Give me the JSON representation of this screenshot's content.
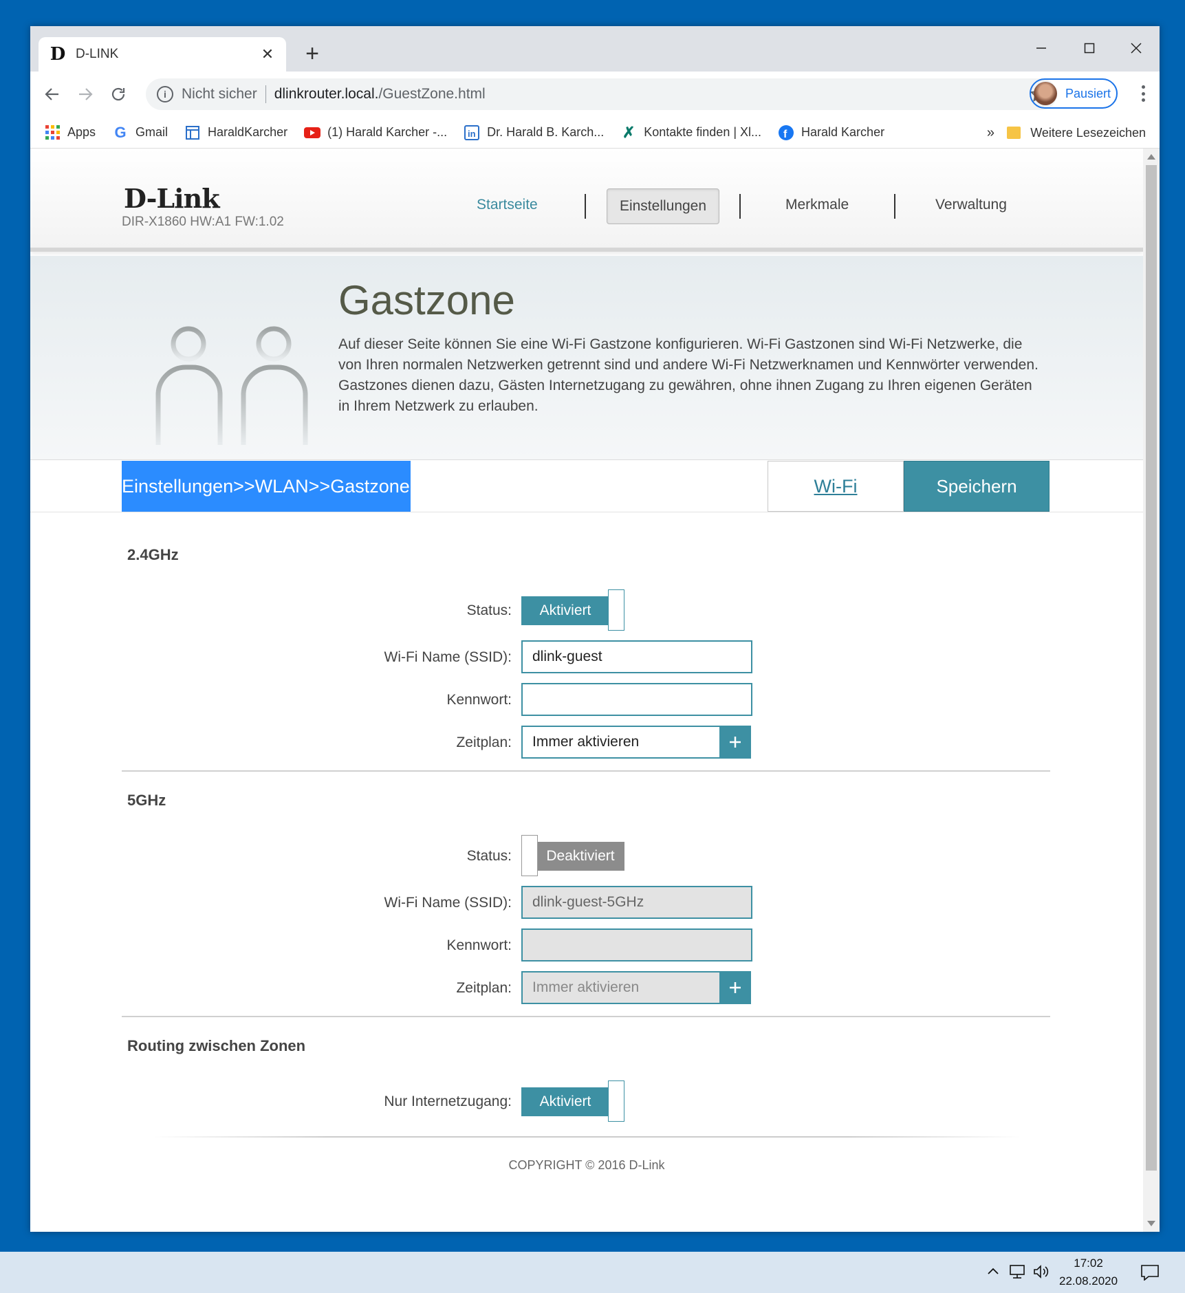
{
  "browser": {
    "tab_title": "D-LINK",
    "omnibox": {
      "security": "Nicht sicher",
      "host": "dlinkrouter.local.",
      "path": "/GuestZone.html"
    },
    "profile_label": "Pausiert",
    "bookmarks": [
      {
        "label": "Apps",
        "icon": "apps-grid-icon"
      },
      {
        "label": "Gmail",
        "icon": "google-icon"
      },
      {
        "label": "HaraldKarcher",
        "icon": "page-icon"
      },
      {
        "label": "(1) Harald Karcher -...",
        "icon": "youtube-icon"
      },
      {
        "label": "Dr. Harald B. Karch...",
        "icon": "linkedin-icon"
      },
      {
        "label": "Kontakte finden | Xl...",
        "icon": "xing-icon"
      },
      {
        "label": "Harald Karcher",
        "icon": "facebook-icon"
      }
    ],
    "bookmarks_more": "»",
    "other_bookmarks": "Weitere Lesezeichen"
  },
  "router": {
    "logo": "D-Link",
    "model": "DIR-X1860 HW:A1 FW:1.02",
    "nav": {
      "home": "Startseite",
      "settings": "Einstellungen",
      "features": "Merkmale",
      "management": "Verwaltung"
    },
    "hero": {
      "title": "Gastzone",
      "description": "Auf dieser Seite können Sie eine Wi-Fi Gastzone konfigurieren. Wi-Fi Gastzonen sind Wi-Fi Netzwerke, die von Ihren normalen Netzwerken getrennt sind und andere Wi-Fi Netzwerknamen und Kennwörter verwenden. Gastzones dienen dazu, Gästen Internetzugang zu gewähren, ohne ihnen Zugang zu Ihren eigenen Geräten in Ihrem Netzwerk zu erlauben."
    },
    "breadcrumb": "Einstellungen>>WLAN>>Gastzone",
    "wifi_button": "Wi-Fi",
    "save_button": "Speichern",
    "band24": {
      "title": "2.4GHz",
      "status_label": "Status:",
      "status_value": "Aktiviert",
      "ssid_label": "Wi-Fi Name (SSID):",
      "ssid_value": "dlink-guest",
      "password_label": "Kennwort:",
      "password_value": "",
      "schedule_label": "Zeitplan:",
      "schedule_value": "Immer aktivieren"
    },
    "band5": {
      "title": "5GHz",
      "status_label": "Status:",
      "status_value": "Deaktiviert",
      "ssid_label": "Wi-Fi Name (SSID):",
      "ssid_value": "dlink-guest-5GHz",
      "password_label": "Kennwort:",
      "password_value": "",
      "schedule_label": "Zeitplan:",
      "schedule_value": "Immer aktivieren"
    },
    "routing": {
      "title": "Routing zwischen Zonen",
      "internet_only_label": "Nur Internetzugang:",
      "internet_only_value": "Aktiviert"
    },
    "copyright": "COPYRIGHT © 2016 D-Link"
  },
  "taskbar": {
    "time": "17:02",
    "date": "22.08.2020"
  },
  "colors": {
    "accent": "#3d90a3",
    "breadcrumb": "#2b8cff",
    "desktop": "#0063b1"
  }
}
